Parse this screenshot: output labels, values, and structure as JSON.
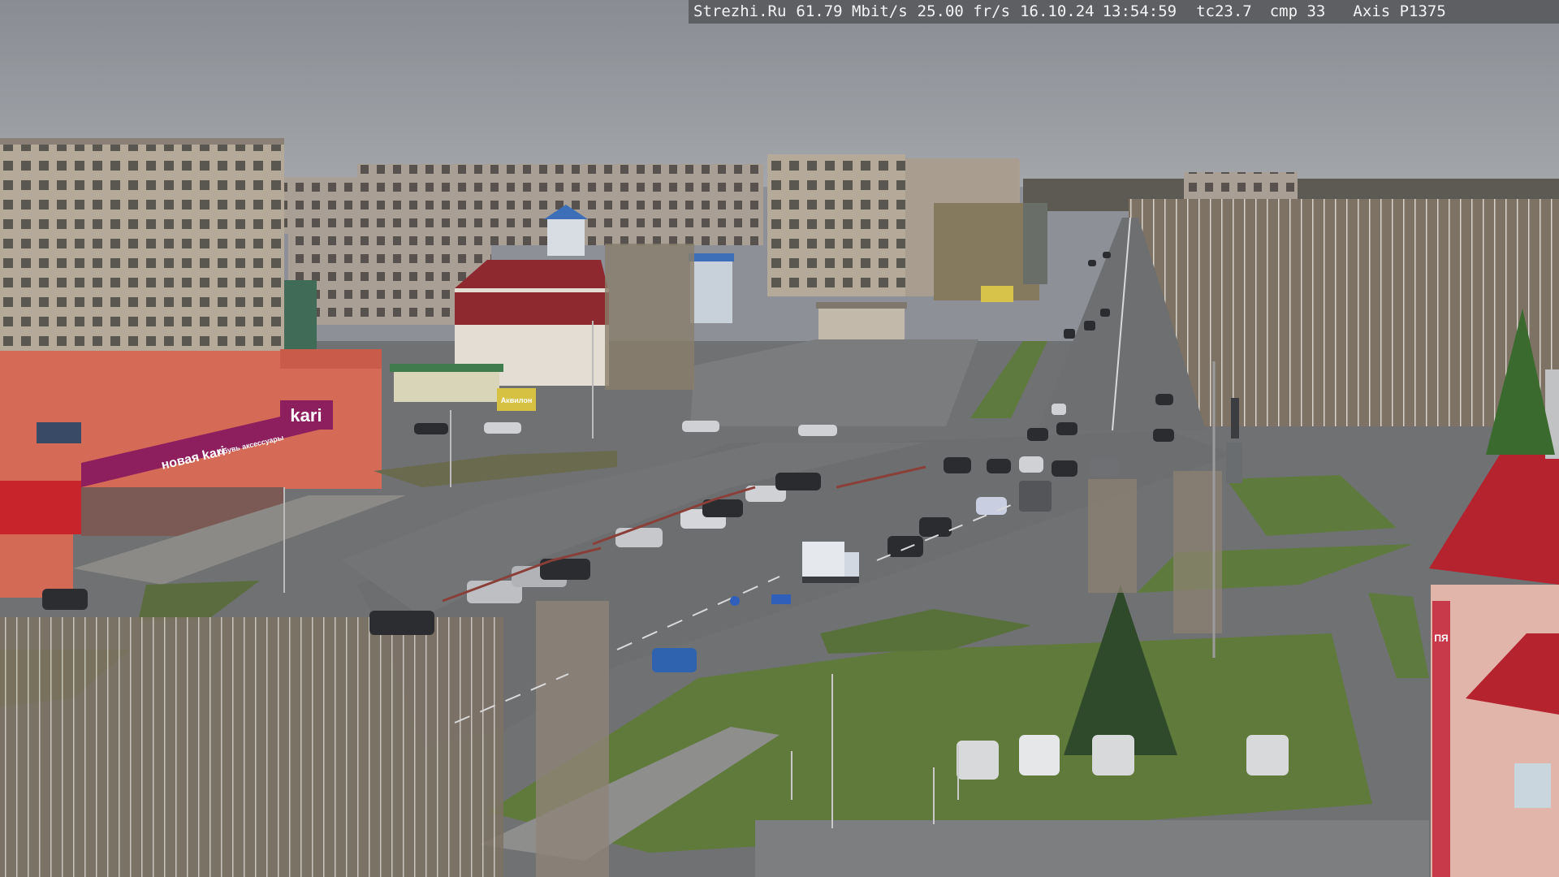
{
  "overlay": {
    "site": "Strezhi.Ru",
    "bitrate": "61.79 Mbit/s",
    "fps": "25.00 fr/s",
    "date": "16.10.24",
    "time": "13:54:59",
    "tc": "tc23.7",
    "cmp": "cmp 33",
    "camera_model": "Axis P1375"
  },
  "signs": {
    "kari_logo": "kari",
    "kari_banner": "новая kari",
    "kari_banner_small": "обувь аксессуары",
    "akvilon": "Аквилон",
    "pharmacy_sign": "ПЯ"
  },
  "colors": {
    "sky": "#8f9398",
    "kari_magenta": "#8e1f5f",
    "road": "#6c6e70",
    "grass": "#5e7a3c",
    "roof_red": "#b5232e",
    "overlay_bg": "#5d5f63"
  }
}
